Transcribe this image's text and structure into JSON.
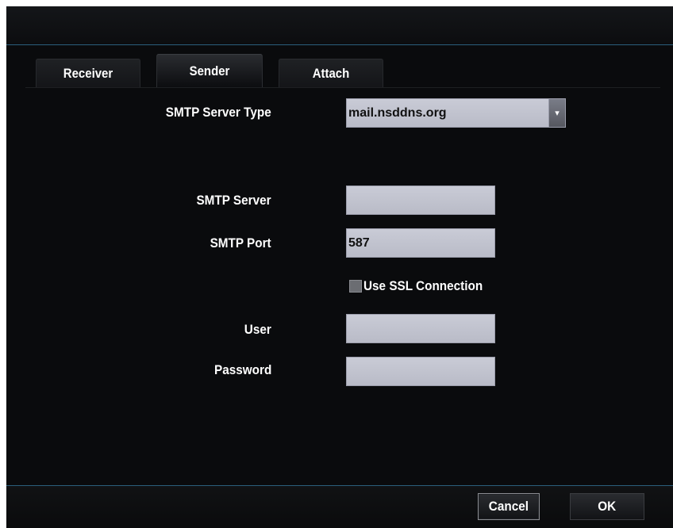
{
  "tabs": [
    {
      "label": "Receiver",
      "active": false
    },
    {
      "label": "Sender",
      "active": true
    },
    {
      "label": "Attach",
      "active": false
    }
  ],
  "form": {
    "server_type": {
      "label": "SMTP Server Type",
      "value": "mail.nsddns.org"
    },
    "server": {
      "label": "SMTP Server",
      "value": ""
    },
    "port": {
      "label": "SMTP Port",
      "value": "587"
    },
    "ssl": {
      "label": "Use SSL Connection",
      "checked": false
    },
    "user": {
      "label": "User",
      "value": ""
    },
    "password": {
      "label": "Password",
      "value": ""
    }
  },
  "buttons": {
    "cancel": "Cancel",
    "ok": "OK"
  },
  "colors": {
    "background": "#0a0b0d",
    "field": "#c3c5d0",
    "accent_line": "#2b5f7c",
    "text": "#ffffff"
  },
  "icons": {
    "dropdown": "chevron-down-icon"
  }
}
